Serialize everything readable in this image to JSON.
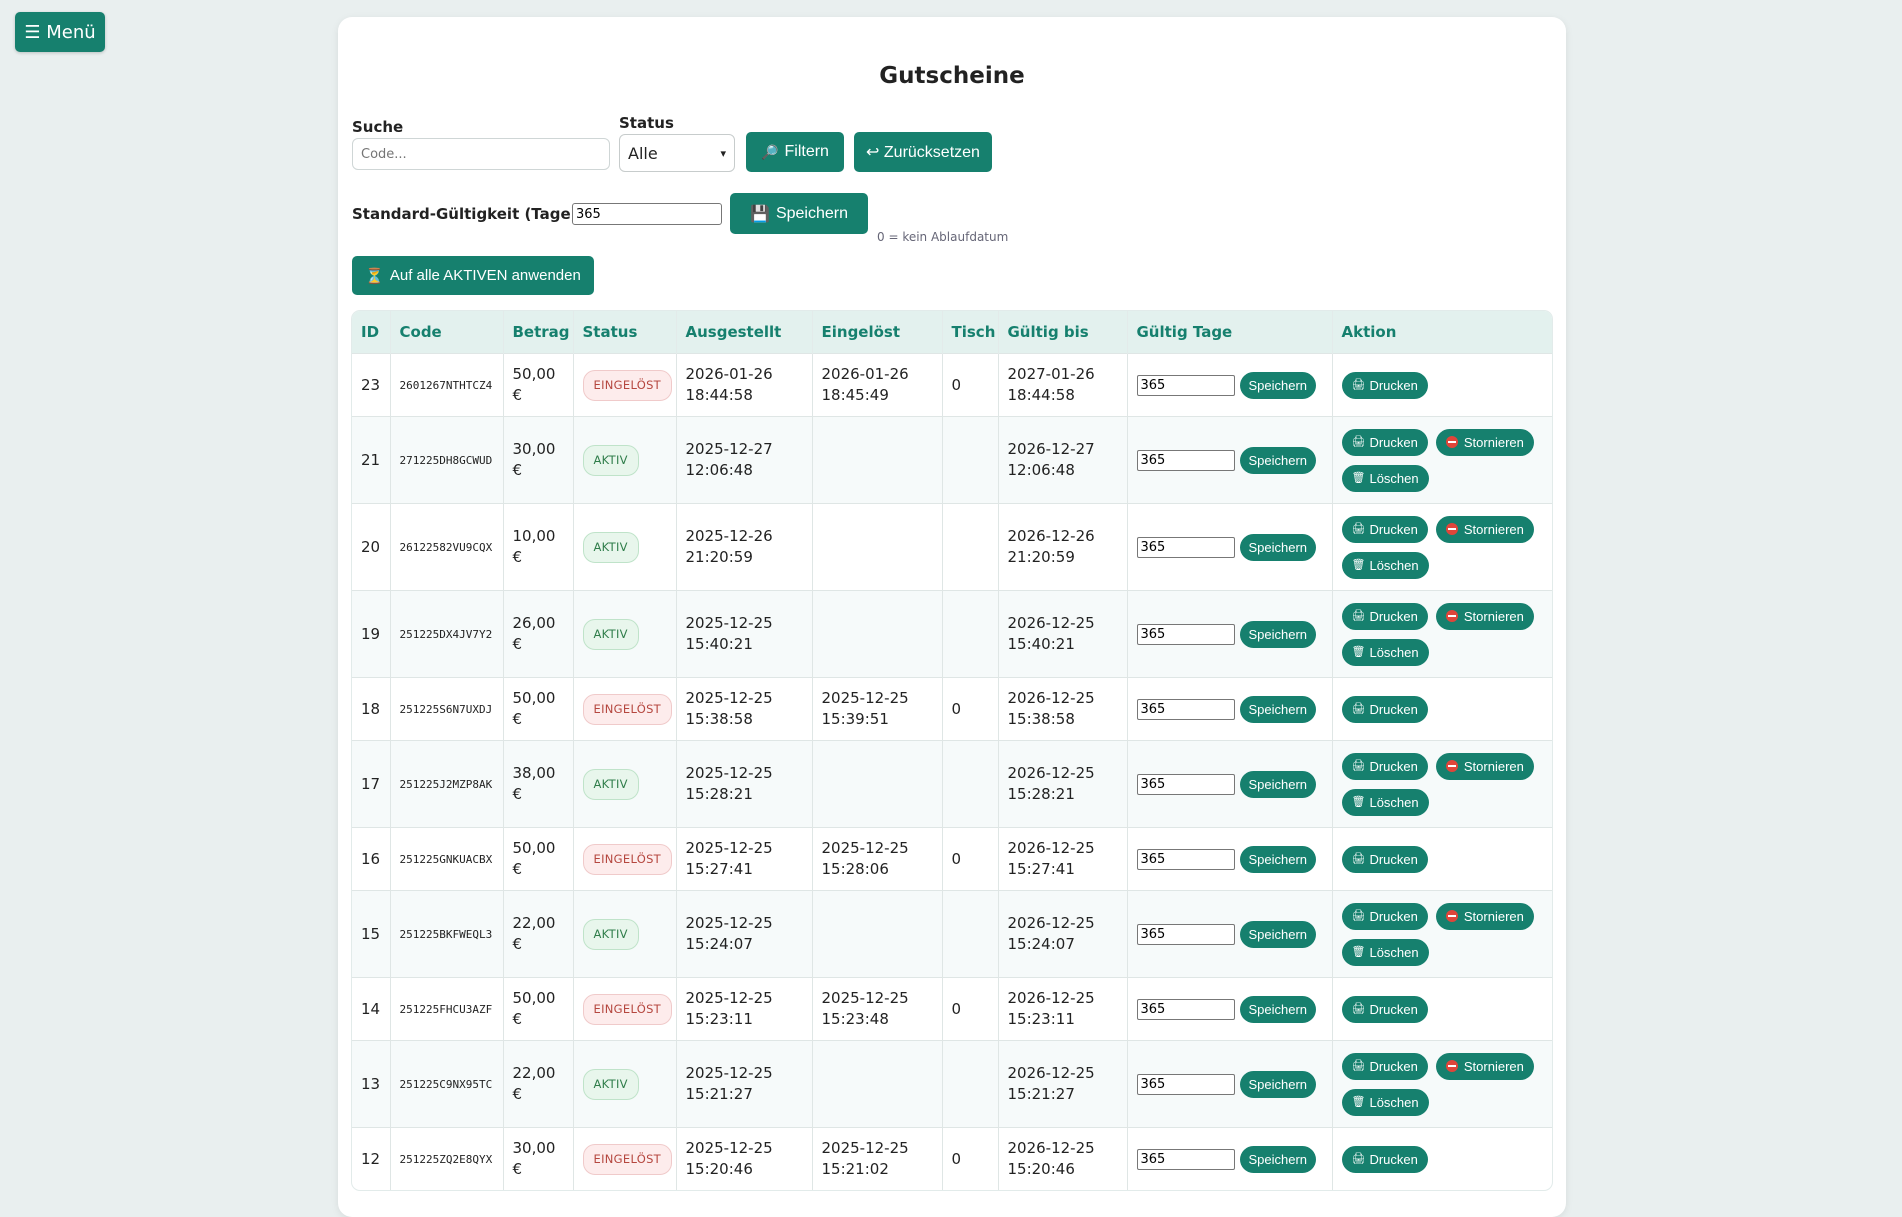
{
  "menu": {
    "icon": "hamburger-icon",
    "label": "☰ Menü"
  },
  "page": {
    "title": "Gutscheine"
  },
  "filters": {
    "search_label": "Suche",
    "search_placeholder": "Code...",
    "status_label": "Status",
    "status_value": "Alle",
    "filter_button": "Filtern",
    "reset_button": "↩ Zurücksetzen"
  },
  "validity": {
    "label": "Standard-Gültigkeit (Tage)",
    "value": "365",
    "save_button": "Speichern",
    "hint": "0 = kein Ablaufdatum",
    "apply_button": "Auf alle AKTIVEN anwenden"
  },
  "table": {
    "headers": [
      "ID",
      "Code",
      "Betrag",
      "Status",
      "Ausgestellt",
      "Eingelöst",
      "Tisch",
      "Gültig bis",
      "Gültig Tage",
      "Aktion"
    ],
    "save_label": "Speichern",
    "print_label": "Drucken",
    "cancel_label": "Stornieren",
    "delete_label": "Löschen",
    "rows": [
      {
        "id": "23",
        "code": "2601267NTHTCZ4",
        "amount": "50,00 €",
        "status": "EINGELÖST",
        "issued": "2026-01-26 18:44:58",
        "redeemed": "2026-01-26 18:45:49",
        "table_no": "0",
        "valid_until": "2027-01-26 18:44:58",
        "days": "365"
      },
      {
        "id": "21",
        "code": "271225DH8GCWUD",
        "amount": "30,00 €",
        "status": "AKTIV",
        "issued": "2025-12-27 12:06:48",
        "redeemed": "",
        "table_no": "",
        "valid_until": "2026-12-27 12:06:48",
        "days": "365"
      },
      {
        "id": "20",
        "code": "26122582VU9CQX",
        "amount": "10,00 €",
        "status": "AKTIV",
        "issued": "2025-12-26 21:20:59",
        "redeemed": "",
        "table_no": "",
        "valid_until": "2026-12-26 21:20:59",
        "days": "365"
      },
      {
        "id": "19",
        "code": "251225DX4JV7Y2",
        "amount": "26,00 €",
        "status": "AKTIV",
        "issued": "2025-12-25 15:40:21",
        "redeemed": "",
        "table_no": "",
        "valid_until": "2026-12-25 15:40:21",
        "days": "365"
      },
      {
        "id": "18",
        "code": "251225S6N7UXDJ",
        "amount": "50,00 €",
        "status": "EINGELÖST",
        "issued": "2025-12-25 15:38:58",
        "redeemed": "2025-12-25 15:39:51",
        "table_no": "0",
        "valid_until": "2026-12-25 15:38:58",
        "days": "365"
      },
      {
        "id": "17",
        "code": "251225J2MZP8AK",
        "amount": "38,00 €",
        "status": "AKTIV",
        "issued": "2025-12-25 15:28:21",
        "redeemed": "",
        "table_no": "",
        "valid_until": "2026-12-25 15:28:21",
        "days": "365"
      },
      {
        "id": "16",
        "code": "251225GNKUACBX",
        "amount": "50,00 €",
        "status": "EINGELÖST",
        "issued": "2025-12-25 15:27:41",
        "redeemed": "2025-12-25 15:28:06",
        "table_no": "0",
        "valid_until": "2026-12-25 15:27:41",
        "days": "365"
      },
      {
        "id": "15",
        "code": "251225BKFWEQL3",
        "amount": "22,00 €",
        "status": "AKTIV",
        "issued": "2025-12-25 15:24:07",
        "redeemed": "",
        "table_no": "",
        "valid_until": "2026-12-25 15:24:07",
        "days": "365"
      },
      {
        "id": "14",
        "code": "251225FHCU3AZF",
        "amount": "50,00 €",
        "status": "EINGELÖST",
        "issued": "2025-12-25 15:23:11",
        "redeemed": "2025-12-25 15:23:48",
        "table_no": "0",
        "valid_until": "2026-12-25 15:23:11",
        "days": "365"
      },
      {
        "id": "13",
        "code": "251225C9NX95TC",
        "amount": "22,00 €",
        "status": "AKTIV",
        "issued": "2025-12-25 15:21:27",
        "redeemed": "",
        "table_no": "",
        "valid_until": "2026-12-25 15:21:27",
        "days": "365"
      },
      {
        "id": "12",
        "code": "251225ZQ2E8QYX",
        "amount": "30,00 €",
        "status": "EINGELÖST",
        "issued": "2025-12-25 15:20:46",
        "redeemed": "2025-12-25 15:21:02",
        "table_no": "0",
        "valid_until": "2026-12-25 15:20:46",
        "days": "365"
      }
    ]
  }
}
